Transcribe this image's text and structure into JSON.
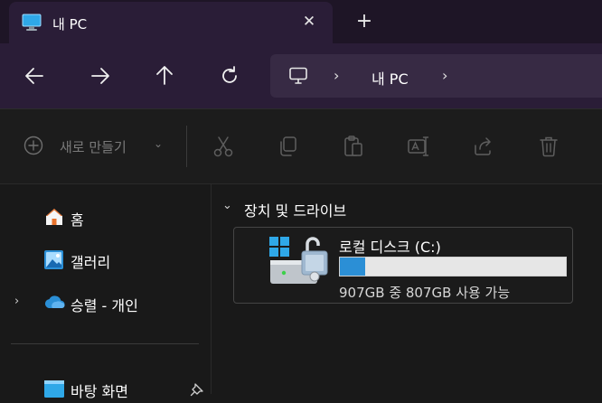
{
  "tab": {
    "title": "내 PC",
    "close_label": "✕",
    "new_tab_label": "+"
  },
  "navigation": {
    "back": "back-arrow",
    "forward": "forward-arrow",
    "up": "up-arrow",
    "refresh": "refresh"
  },
  "address_bar": {
    "separator": "›",
    "location": "내 PC"
  },
  "toolbar": {
    "new_label": "새로 만들기"
  },
  "sidebar": {
    "items": [
      {
        "label": "홈"
      },
      {
        "label": "갤러리"
      },
      {
        "label": "승렬 - 개인"
      },
      {
        "label": "바탕 화면"
      }
    ]
  },
  "main": {
    "section_title": "장치 및 드라이브",
    "drives": [
      {
        "name": "로컬 디스크 (C:)",
        "free_text": "907GB 중 807GB 사용 가능",
        "used_fraction": 0.11
      }
    ]
  },
  "colors": {
    "accent": "#2b8fd6",
    "titlebar": "#1e1526",
    "navbar": "#2a1d37"
  }
}
